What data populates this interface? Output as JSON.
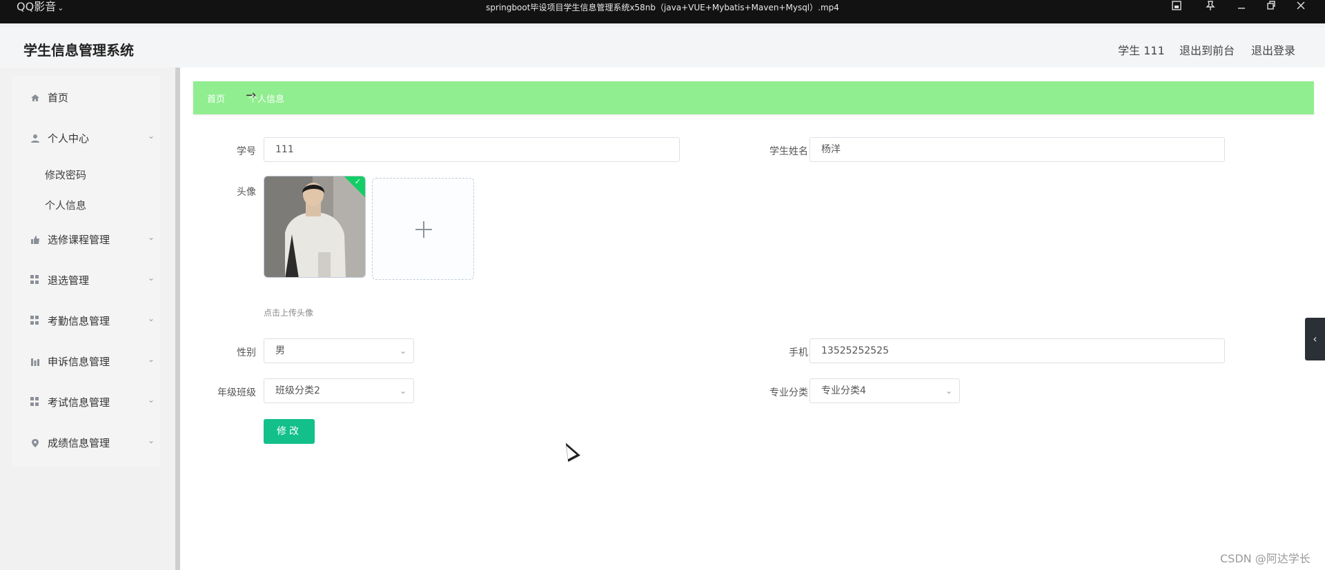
{
  "player": {
    "brand": "QQ影音",
    "title": "springboot毕设项目学生信息管理系统x58nb（java+VUE+Mybatis+Maven+Mysql）.mp4"
  },
  "header": {
    "title": "学生信息管理系统",
    "user": "学生 111",
    "exit_front": "退出到前台",
    "logout": "退出登录"
  },
  "sidebar": {
    "items": [
      {
        "label": "首页",
        "icon": "home-icon"
      },
      {
        "label": "个人中心",
        "icon": "user-icon",
        "expanded": true,
        "children": [
          "修改密码",
          "个人信息"
        ]
      },
      {
        "label": "选修课程管理",
        "icon": "thumb-icon"
      },
      {
        "label": "退选管理",
        "icon": "grid-icon"
      },
      {
        "label": "考勤信息管理",
        "icon": "grid-icon"
      },
      {
        "label": "申诉信息管理",
        "icon": "chart-icon"
      },
      {
        "label": "考试信息管理",
        "icon": "grid-icon"
      },
      {
        "label": "成绩信息管理",
        "icon": "location-icon"
      }
    ]
  },
  "breadcrumb": {
    "home": "首页",
    "separator": "→",
    "current": "个人信息"
  },
  "form": {
    "student_no_label": "学号",
    "student_no": "111",
    "student_name_label": "学生姓名",
    "student_name": "杨洋",
    "avatar_label": "头像",
    "avatar_tip": "点击上传头像",
    "gender_label": "性别",
    "gender": "男",
    "phone_label": "手机",
    "phone": "13525252525",
    "class_label": "年级班级",
    "class": "班级分类2",
    "major_label": "专业分类",
    "major": "专业分类4",
    "submit": "修改"
  },
  "watermark": "CSDN @阿达学长",
  "colors": {
    "breadcrumb_bg": "#90ee90",
    "primary_button": "#13c08a",
    "upload_success": "#13ce66"
  }
}
